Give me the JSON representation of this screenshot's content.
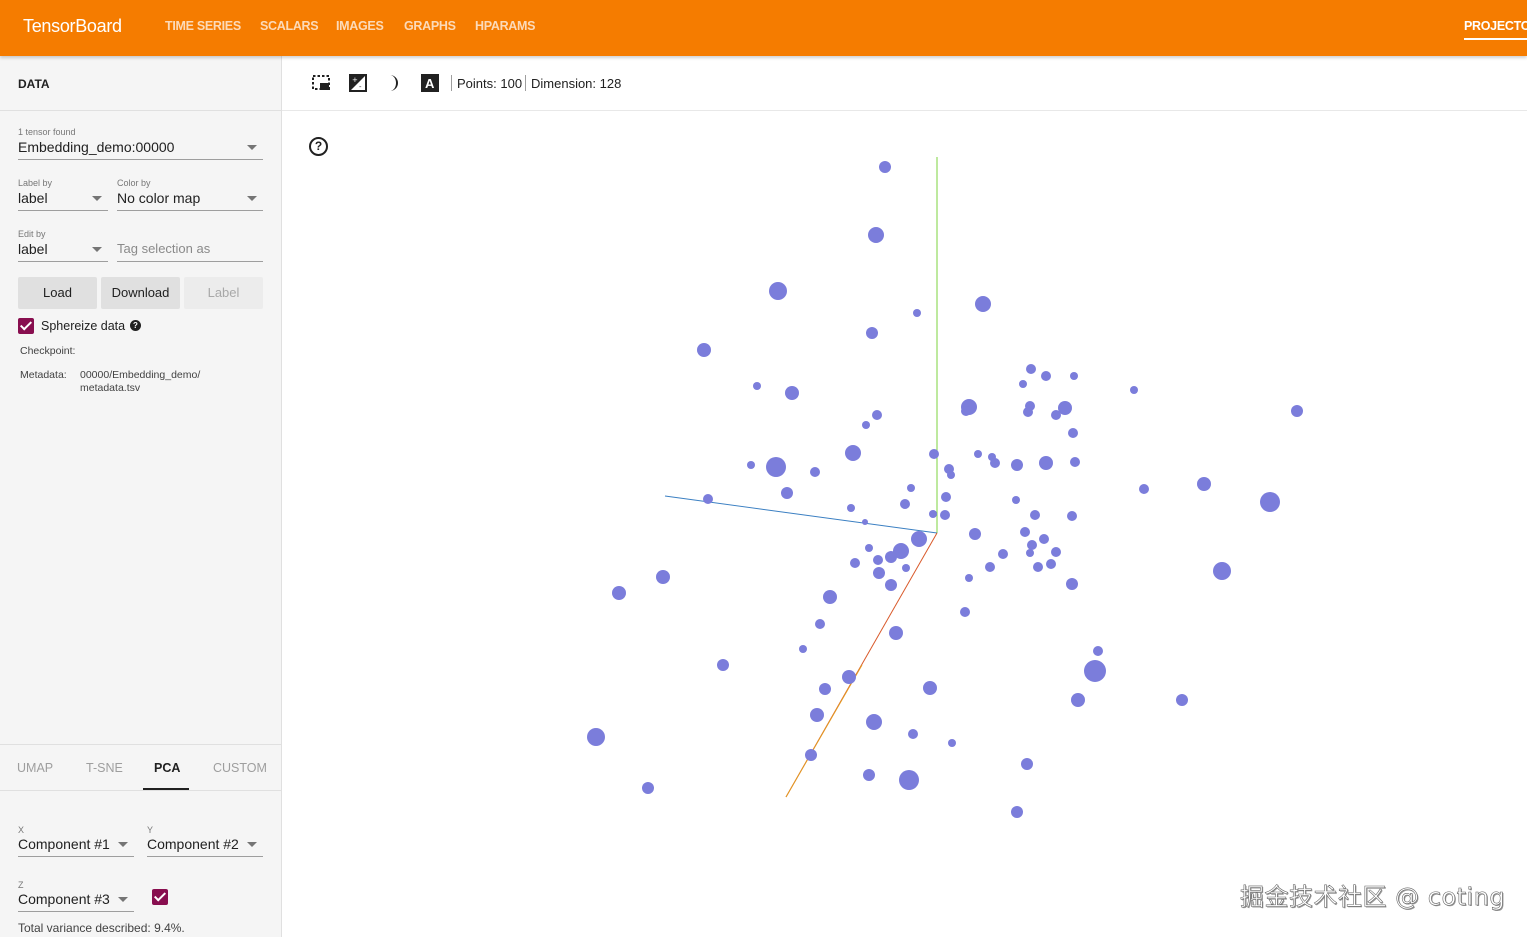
{
  "app": {
    "title": "TensorBoard",
    "accent_color": "#f57c00",
    "point_color": "#7b7ddb"
  },
  "nav": {
    "tabs": [
      {
        "label": "TIME SERIES"
      },
      {
        "label": "SCALARS"
      },
      {
        "label": "IMAGES"
      },
      {
        "label": "GRAPHS"
      },
      {
        "label": "HPARAMS"
      }
    ],
    "active_label": "PROJECTO"
  },
  "data_panel": {
    "title": "DATA",
    "tensor_found": "1 tensor found",
    "tensor_value": "Embedding_demo:00000",
    "label_by": {
      "label": "Label by",
      "value": "label"
    },
    "color_by": {
      "label": "Color by",
      "value": "No color map"
    },
    "edit_by": {
      "label": "Edit by",
      "value": "label"
    },
    "tag_selection_placeholder": "Tag selection as",
    "buttons": {
      "load": "Load",
      "download": "Download",
      "label": "Label"
    },
    "sphereize": {
      "label": "Sphereize data",
      "checked": true
    },
    "checkpoint_label": "Checkpoint:",
    "metadata_label": "Metadata:",
    "metadata_line1": "00000/Embedding_demo/",
    "metadata_line2": "metadata.tsv"
  },
  "projection_tabs": {
    "tabs": [
      "UMAP",
      "T-SNE",
      "PCA",
      "CUSTOM"
    ],
    "active": "PCA"
  },
  "pca": {
    "x": {
      "label": "X",
      "value": "Component #1"
    },
    "y": {
      "label": "Y",
      "value": "Component #2"
    },
    "z": {
      "label": "Z",
      "value": "Component #3",
      "enabled": true
    },
    "variance_text": "Total variance described: 9.4%."
  },
  "toolbar": {
    "icons": [
      "select-rectangle-icon",
      "edit-contrast-icon",
      "night-mode-icon",
      "text-label-icon"
    ],
    "points": "Points: 100",
    "dimension": "Dimension: 128"
  },
  "plot": {
    "help": "?",
    "watermark": "掘金技术社区 @ coting"
  }
}
